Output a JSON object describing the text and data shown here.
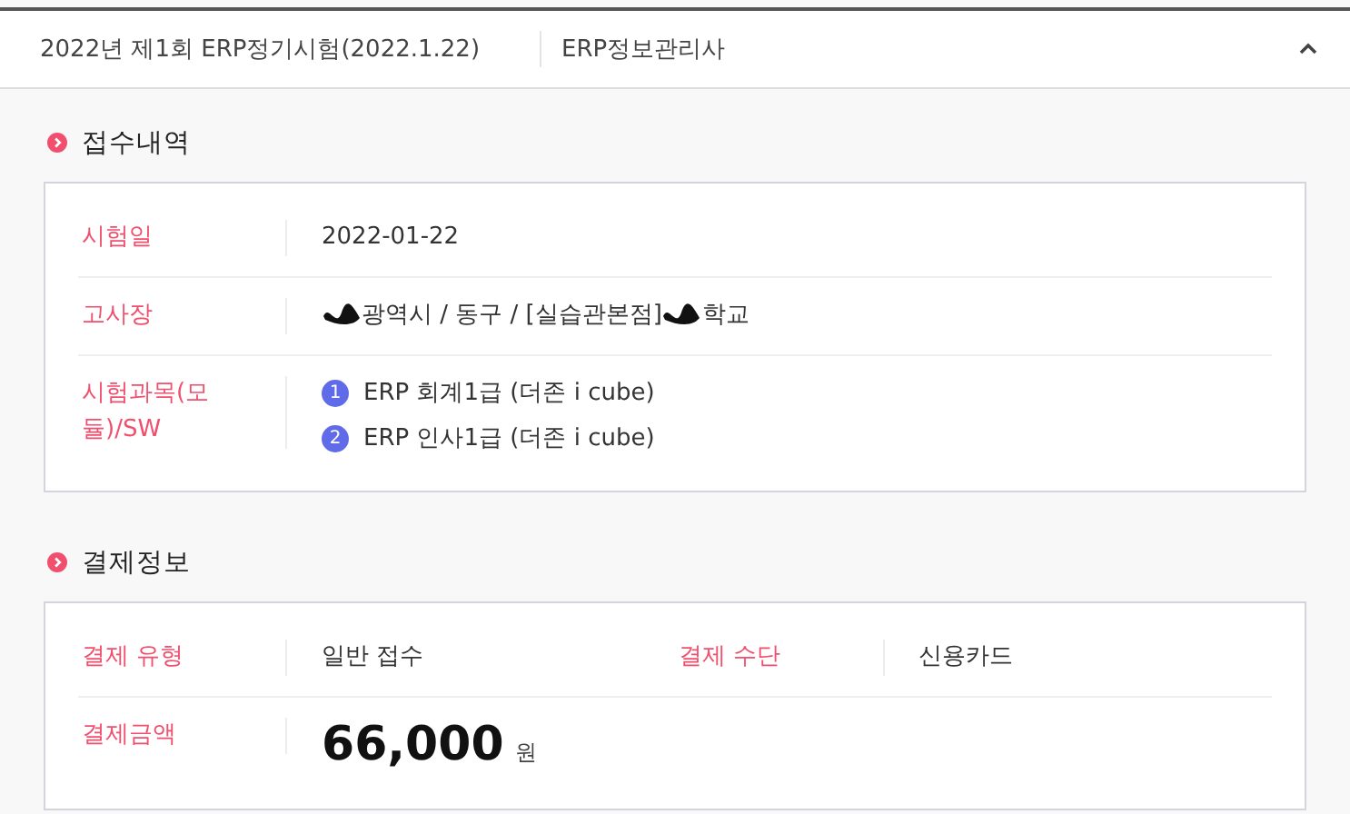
{
  "header": {
    "exam": "2022년 제1회 ERP정기시험(2022.1.22)",
    "certificate": "ERP정보관리사",
    "expanded": true
  },
  "registration": {
    "title": "접수내역",
    "exam_date": {
      "label": "시험일",
      "value": "2022-01-22"
    },
    "venue": {
      "label": "고사장",
      "segments": [
        {
          "kind": "redacted"
        },
        {
          "kind": "text",
          "text": "광역시 / 동구 / [실습관본점]"
        },
        {
          "kind": "redacted"
        },
        {
          "kind": "text",
          "text": "학교"
        }
      ]
    },
    "subjects": {
      "label": "시험과목(모듈)/SW",
      "items": [
        {
          "number": "1",
          "name": "ERP 회계1급 (더존 i cube)"
        },
        {
          "number": "2",
          "name": "ERP 인사1급 (더존 i cube)"
        }
      ]
    }
  },
  "payment": {
    "title": "결제정보",
    "type": {
      "label": "결제 유형",
      "value": "일반 접수"
    },
    "method": {
      "label": "결제 수단",
      "value": "신용카드"
    },
    "amount": {
      "label": "결제금액",
      "value": "66,000",
      "unit": "원"
    }
  }
}
